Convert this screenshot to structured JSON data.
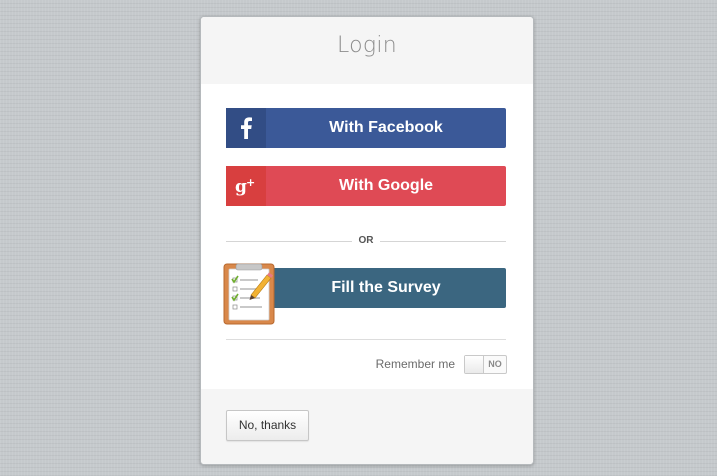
{
  "modal": {
    "title": "Login"
  },
  "buttons": {
    "facebook": {
      "label": "With Facebook",
      "icon": "facebook-f-icon",
      "color": "#3b5998"
    },
    "google": {
      "label": "With Google",
      "icon": "google-plus-icon",
      "color": "#df4a55"
    },
    "survey": {
      "label": "Fill the Survey",
      "icon": "clipboard-checklist-icon",
      "color": "#3b6680"
    }
  },
  "divider": {
    "text": "OR"
  },
  "remember": {
    "label": "Remember me",
    "toggle_state": "NO"
  },
  "footer": {
    "dismiss_label": "No, thanks"
  }
}
